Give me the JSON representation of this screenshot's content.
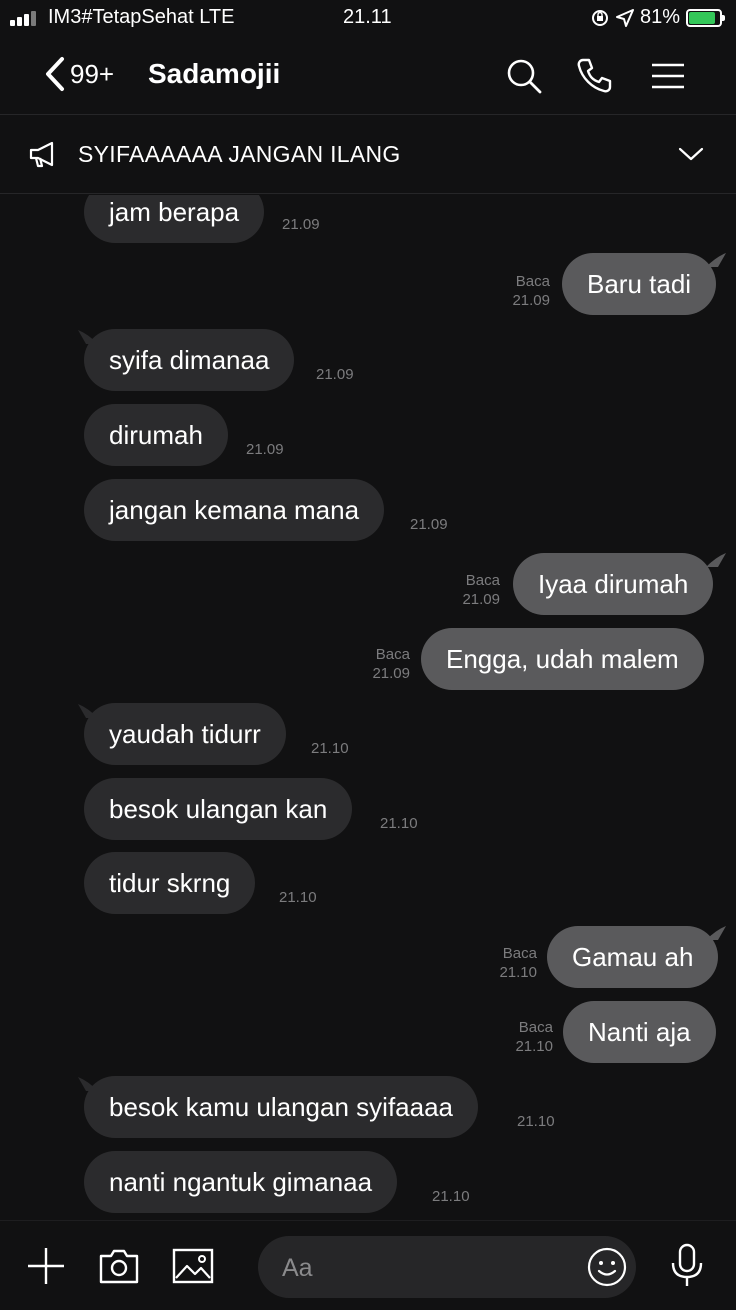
{
  "status": {
    "carrier": "IM3#TetapSehat LTE",
    "time": "21.11",
    "battery": "81%"
  },
  "header": {
    "back_count": "99+",
    "title": "Sadamojii"
  },
  "announcement": {
    "text": "SYIFAAAAAA JANGAN ILANG"
  },
  "messages": [
    {
      "dir": "in",
      "text": "jam berapa",
      "time": "21.09"
    },
    {
      "dir": "out",
      "text": "Baru tadi",
      "read": "Baca",
      "time": "21.09"
    },
    {
      "dir": "in",
      "text": "syifa dimanaa",
      "time": "21.09"
    },
    {
      "dir": "in",
      "text": "dirumah",
      "time": "21.09"
    },
    {
      "dir": "in",
      "text": "jangan kemana mana",
      "time": "21.09"
    },
    {
      "dir": "out",
      "text": "Iyaa dirumah",
      "read": "Baca",
      "time": "21.09"
    },
    {
      "dir": "out",
      "text": "Engga, udah malem",
      "read": "Baca",
      "time": "21.09"
    },
    {
      "dir": "in",
      "text": "yaudah tidurr",
      "time": "21.10"
    },
    {
      "dir": "in",
      "text": "besok ulangan kan",
      "time": "21.10"
    },
    {
      "dir": "in",
      "text": "tidur skrng",
      "time": "21.10"
    },
    {
      "dir": "out",
      "text": "Gamau ah",
      "read": "Baca",
      "time": "21.10"
    },
    {
      "dir": "out",
      "text": "Nanti aja",
      "read": "Baca",
      "time": "21.10"
    },
    {
      "dir": "in",
      "text": "besok kamu ulangan syifaaaa",
      "time": "21.10"
    },
    {
      "dir": "in",
      "text": "nanti ngantuk gimanaa",
      "time": "21.10"
    }
  ],
  "input": {
    "placeholder": "Aa"
  },
  "colors": {
    "background": "#111112",
    "incoming_bubble": "#2b2b2d",
    "outgoing_bubble": "#5a5a5c",
    "battery_charging": "#34c759"
  }
}
